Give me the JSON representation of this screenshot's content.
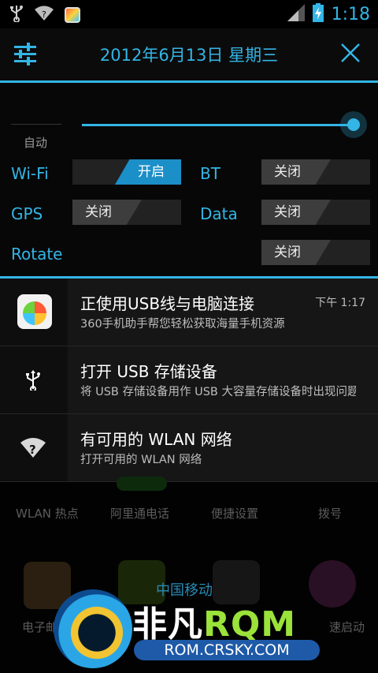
{
  "status_bar": {
    "time": "1:18",
    "icons": [
      "usb-icon",
      "wifi-question-icon",
      "app-icon",
      "signal-icon",
      "battery-charging-icon"
    ]
  },
  "header": {
    "date": "2012年6月13日 星期三",
    "settings_icon": "settings-sliders-icon",
    "close_icon": "close-icon"
  },
  "quick_settings": {
    "brightness": {
      "auto_label": "自动",
      "level": 1.0
    },
    "toggles": [
      {
        "label": "Wi-Fi",
        "state": "开启",
        "on": true
      },
      {
        "label": "BT",
        "state": "关闭",
        "on": false
      },
      {
        "label": "GPS",
        "state": "关闭",
        "on": false
      },
      {
        "label": "Data",
        "state": "关闭",
        "on": false
      },
      {
        "label": "Rotate",
        "state": "关闭",
        "on": false
      }
    ]
  },
  "notifications": [
    {
      "title": "正使用USB线与电脑连接",
      "subtitle": "360手机助手帮您轻松获取海量手机资源",
      "time": "下午 1:17",
      "icon": "app-360-icon"
    },
    {
      "title": "打开 USB 存储设备",
      "subtitle": "将 USB 存储设备用作 USB 大容量存储设备时出现问题",
      "icon": "usb-icon"
    },
    {
      "title": "有可用的 WLAN 网络",
      "subtitle": "打开可用的 WLAN 网络",
      "icon": "wifi-question-icon"
    }
  ],
  "launcher": {
    "row1": [
      "WLAN 热点",
      "阿里通电话",
      "便捷设置",
      "拨号"
    ],
    "row2_left": "电子邮",
    "row2_right": "速启动",
    "carrier": "中国移动"
  },
  "watermark": {
    "brand_part1": "非凡",
    "brand_part2": "RQM",
    "url": "ROM.CRSKY.COM"
  },
  "colors": {
    "accent": "#33b5e5",
    "rom_green": "#9be23a"
  }
}
